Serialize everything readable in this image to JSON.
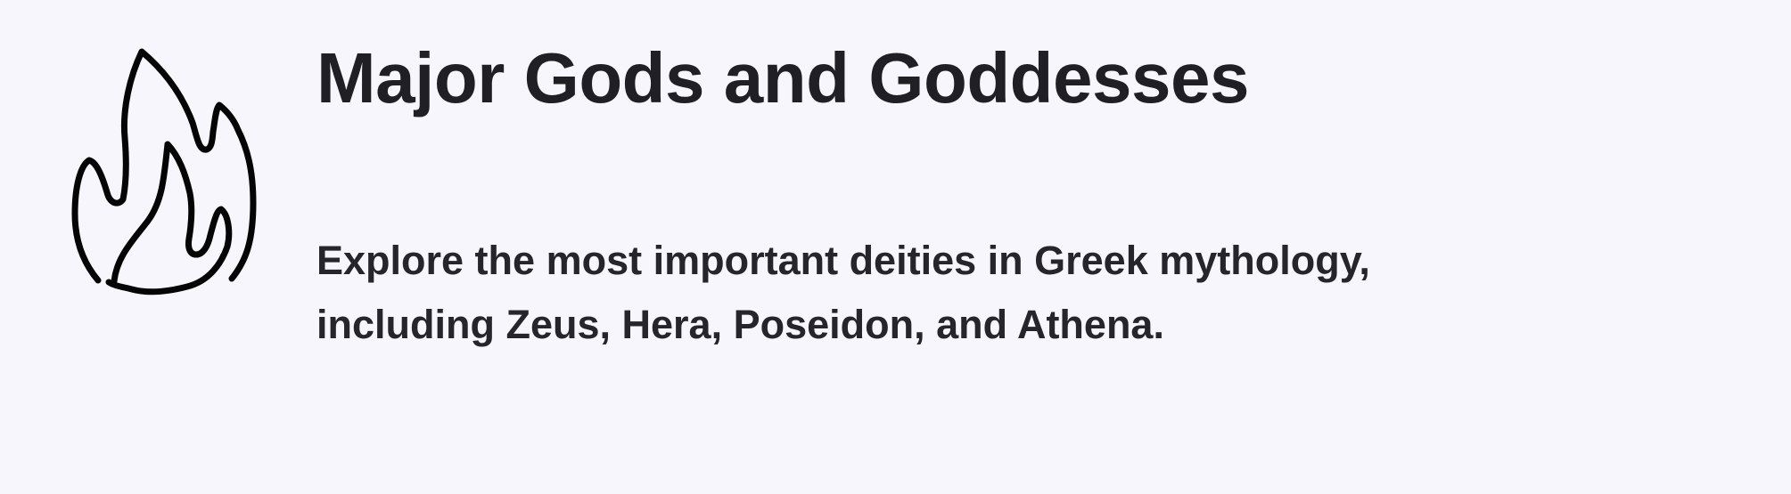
{
  "card": {
    "icon": "flame-icon",
    "title": "Major Gods and Goddesses",
    "description": "Explore the most important deities in Greek mythology, including Zeus, Hera, Poseidon, and Athena."
  },
  "colors": {
    "background": "#f8f6fd",
    "text": "#1f1f24",
    "icon_stroke": "#050505"
  }
}
